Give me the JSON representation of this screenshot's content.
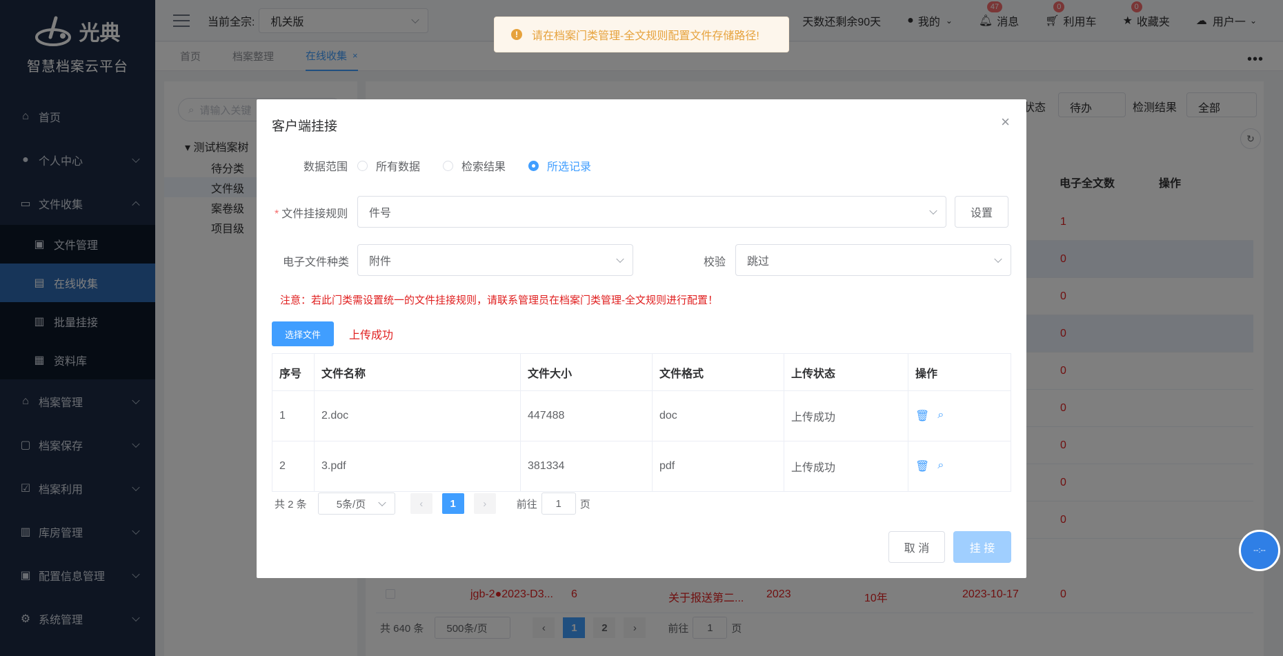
{
  "sidebar": {
    "logo_text": "光典",
    "platform": "智慧档案云平台",
    "items": [
      {
        "label": "首页"
      },
      {
        "label": "个人中心"
      },
      {
        "label": "文件收集"
      },
      {
        "label": "档案管理"
      },
      {
        "label": "档案保存"
      },
      {
        "label": "档案利用"
      },
      {
        "label": "库房管理"
      },
      {
        "label": "配置信息管理"
      },
      {
        "label": "系统管理"
      }
    ],
    "subitems": [
      {
        "label": "文件管理"
      },
      {
        "label": "在线收集"
      },
      {
        "label": "批量挂接"
      },
      {
        "label": "资料库"
      }
    ]
  },
  "topbar": {
    "zone_label": "当前全宗:",
    "zone_value": "机关版",
    "days_left": "天数还剩余90天",
    "mine": "我的",
    "messages": "消息",
    "messages_badge": "47",
    "cart": "利用车",
    "cart_badge": "0",
    "favorites": "收藏夹",
    "favorites_badge": "0",
    "user": "用户一"
  },
  "tabs": [
    {
      "label": "首页"
    },
    {
      "label": "档案整理"
    },
    {
      "label": "在线收集"
    }
  ],
  "left_panel": {
    "search_placeholder": "请输入关键",
    "tree_root": "测试档案树",
    "nodes": [
      "待分类",
      "文件级",
      "案卷级",
      "项目级"
    ]
  },
  "background": {
    "status_label": "状态",
    "status_value": "待办",
    "result_label": "检测结果",
    "result_value": "全部",
    "col_fulltext": "电子全文数",
    "col_ops": "操作",
    "row_values": [
      "1",
      "0",
      "0",
      "0",
      "0",
      "0",
      "0",
      "0",
      "0",
      "0"
    ],
    "last_row": {
      "code": "jgb-2●2023-D3...",
      "num": "6",
      "title": "关于报送第二...",
      "year": "2023",
      "period": "10年",
      "date": "2023-10-17",
      "count": "0"
    },
    "pager_total": "共 640 条",
    "pager_size": "500条/页",
    "pager_pages": [
      "1",
      "2"
    ],
    "goto": "前往",
    "goto_value": "1",
    "page_unit": "页"
  },
  "toast": {
    "message": "请在档案门类管理-全文规则配置文件存储路径!"
  },
  "dialog": {
    "title": "客户端挂接",
    "scope_label": "数据范围",
    "scope_options": [
      "所有数据",
      "检索结果",
      "所选记录"
    ],
    "rule_label": "文件挂接规则",
    "rule_value": "件号",
    "settings_button": "设置",
    "type_label": "电子文件种类",
    "type_value": "附件",
    "check_label": "校验",
    "check_value": "跳过",
    "note": "注意：若此门类需设置统一的文件挂接规则，请联系管理员在档案门类管理-全文规则进行配置！",
    "choose_button": "选择文件",
    "upload_status": "上传成功",
    "columns": [
      "序号",
      "文件名称",
      "文件大小",
      "文件格式",
      "上传状态",
      "操作"
    ],
    "rows": [
      {
        "no": "1",
        "name": "2.doc",
        "size": "447488",
        "format": "doc",
        "status": "上传成功"
      },
      {
        "no": "2",
        "name": "3.pdf",
        "size": "381334",
        "format": "pdf",
        "status": "上传成功"
      }
    ],
    "pager": {
      "total": "共 2 条",
      "size": "5条/页",
      "page": "1",
      "goto": "前往",
      "goto_value": "1",
      "unit": "页"
    },
    "cancel_button": "取 消",
    "ok_button": "挂 接"
  },
  "float_ball": "--:--"
}
